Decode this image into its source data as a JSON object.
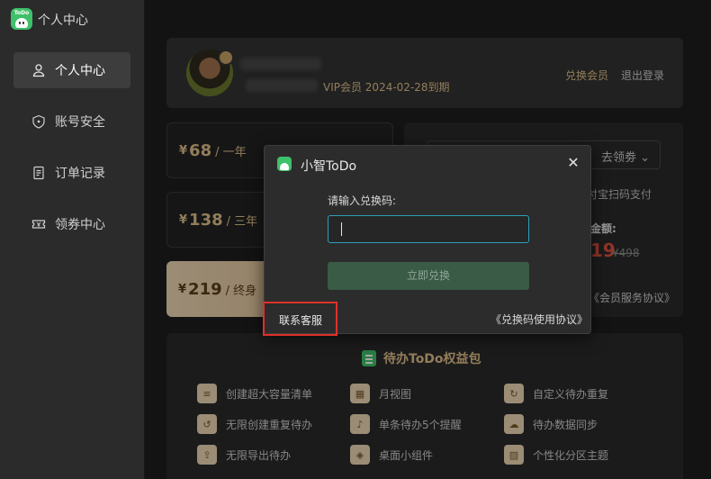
{
  "window": {
    "title": "个人中心",
    "logo_text": "ToDo",
    "minimize": "—",
    "close": "✕"
  },
  "sidebar": {
    "items": [
      {
        "label": "个人中心",
        "icon": "user-icon",
        "active": true
      },
      {
        "label": "账号安全",
        "icon": "shield-icon",
        "active": false
      },
      {
        "label": "订单记录",
        "icon": "document-icon",
        "active": false
      },
      {
        "label": "领券中心",
        "icon": "ticket-icon",
        "active": false
      }
    ]
  },
  "profile": {
    "vip_info": "VIP会员   2024-02-28到期",
    "redeem_link": "兑换会员",
    "logout_link": "退出登录"
  },
  "plans": [
    {
      "currency": "¥",
      "price": "68",
      "period": "/ 一年"
    },
    {
      "currency": "¥",
      "price": "138",
      "period": "/ 三年"
    },
    {
      "currency": "¥",
      "price": "219",
      "period": "/ 终身"
    }
  ],
  "payment": {
    "coupon_text": "去领劵",
    "pay_tip": "付宝扫码支付",
    "amount_label": "金额:",
    "amount_now": "19",
    "amount_old": "¥498",
    "agreement": "《会员服务协议》"
  },
  "benefits": {
    "title": "待办ToDo权益包",
    "items": [
      {
        "label": "创建超大容量清单",
        "icon": "list-add-icon"
      },
      {
        "label": "月视图",
        "icon": "calendar-icon"
      },
      {
        "label": "自定义待办重复",
        "icon": "repeat-icon"
      },
      {
        "label": "无限创建重复待办",
        "icon": "repeat-infinite-icon"
      },
      {
        "label": "单条待办5个提醒",
        "icon": "bell-icon"
      },
      {
        "label": "待办数据同步",
        "icon": "cloud-sync-icon"
      },
      {
        "label": "无限导出待办",
        "icon": "export-icon"
      },
      {
        "label": "桌面小组件",
        "icon": "widget-icon"
      },
      {
        "label": "个性化分区主题",
        "icon": "theme-icon"
      }
    ]
  },
  "dialog": {
    "title": "小智ToDo",
    "close": "✕",
    "label": "请输入兑换码:",
    "input_value": "",
    "button": "立即兑换",
    "contact": "联系客服",
    "agreement": "《兑换码使用协议》"
  },
  "colors": {
    "accent_gold": "#e0c08a",
    "brand_green": "#3fc06a",
    "price_red": "#e24f3c",
    "highlight_red": "#e0302a"
  }
}
